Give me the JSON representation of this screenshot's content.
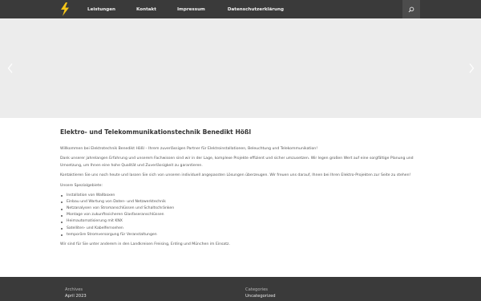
{
  "nav": {
    "items": [
      "Leistungen",
      "Kontakt",
      "Impressum",
      "Datenschutzerklärung"
    ],
    "logo_icon": "lightning-bolt-icon",
    "search_icon": "search-icon"
  },
  "slider": {
    "prev_icon": "chevron-left-icon",
    "next_icon": "chevron-right-icon"
  },
  "main": {
    "title": "Elektro- und Telekommunikationstechnik Benedikt Hößl",
    "p1": "Willkommen bei Elektrotechnik Benedikt Hößl – Ihrem zuverlässigen Partner für Elektroinstallationen, Beleuchtung und Telekommunikation!",
    "p2": "Dank unserer jahrelangen Erfahrung und unserem Fachwissen sind wir in der Lage, komplexe Projekte effizient und sicher umzusetzen. Wir legen großen Wert auf eine sorgfältige Planung und Umsetzung, um Ihnen eine hohe Qualität und Zuverlässigkeit zu garantieren.",
    "p3": "Kontaktieren Sie uns noch heute und lassen Sie sich von unseren individuell angepassten Lösungen überzeugen. Wir freuen uns darauf, Ihnen bei Ihren Elektro-Projekten zur Seite zu stehen!",
    "list_heading": "Unsere Spezialgebiete:",
    "specialties": [
      "Installation von Wallboxen",
      "Einbau und Wartung von Daten- und Netzwerktechnik",
      "Netzanalysen von Stromanschlüssen und Schaltschränken",
      "Montage von zukunftssicheren Glasfaseranschlüssen",
      "Heimautomatisierung mit KNX",
      "Satelliten- und Kabelfernsehen",
      "temporäre Stromversorgung für Veranstaltungen"
    ],
    "p4": "Wir sind für Sie unter anderem in den Landkreisen Freising, Erding und München im Einsatz."
  },
  "footer": {
    "archives_heading": "Archives",
    "archives_link": "April 2023",
    "categories_heading": "Categories",
    "categories_link": "Uncategorized"
  },
  "colors": {
    "bar": "#3a3a3a",
    "logo_yellow": "#f5c518",
    "slider_bg": "#ececec"
  }
}
